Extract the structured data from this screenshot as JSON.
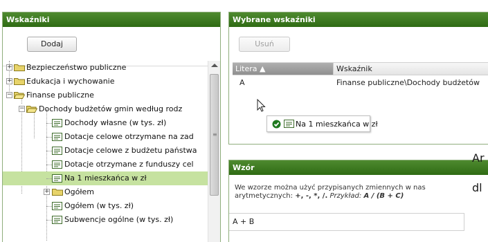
{
  "left_panel": {
    "title": "Wskaźniki",
    "add_button": "Dodaj",
    "tree": [
      {
        "label": "Bezpieczeństwo publiczne",
        "type": "folder",
        "toggle": "+"
      },
      {
        "label": "Edukacja i wychowanie",
        "type": "folder",
        "toggle": "+"
      },
      {
        "label": "Finanse publiczne",
        "type": "folder",
        "toggle": "−"
      },
      {
        "label": "Dochody budżetów gmin według rodz",
        "type": "folder",
        "toggle": "−"
      },
      {
        "label": "Dochody własne (w tys. zł)",
        "type": "indicator"
      },
      {
        "label": "Dotacje celowe otrzymane na zad",
        "type": "indicator"
      },
      {
        "label": "Dotacje celowe z budżetu państwa",
        "type": "indicator"
      },
      {
        "label": "Dotacje otrzymane z funduszy cel",
        "type": "indicator"
      },
      {
        "label": "Na 1 mieszkańca w zł",
        "type": "indicator",
        "selected": true
      },
      {
        "label": "Ogółem",
        "type": "folder",
        "toggle": "+"
      },
      {
        "label": "Ogółem (w tys. zł)",
        "type": "indicator"
      },
      {
        "label": "Subwencje ogólne (w tys. zł)",
        "type": "indicator"
      }
    ]
  },
  "selected_panel": {
    "title": "Wybrane wskaźniki",
    "remove_button": "Usuń",
    "columns": {
      "letter": "Litera ▲",
      "indicator": "Wskaźnik"
    },
    "rows": [
      {
        "letter": "A",
        "indicator": "Finanse publiczne\\Dochody budżetów"
      }
    ],
    "drag_label": "Na 1 mieszkańca w zł"
  },
  "formula_panel": {
    "title": "Wzór",
    "description_line1": "We wzorze można użyć przypisanych zmiennych w nas",
    "description_line2_prefix": "arytmetycznych: ",
    "operators": "+, -, *, /.",
    "example_label": "Przykład:",
    "example_value": "A / (B + C)",
    "formula_value": "A + B"
  },
  "peek_text": {
    "a": "Ar",
    "b": "dl"
  },
  "colors": {
    "header": "#2f6b14",
    "selection": "#c6e2a0",
    "accent_check": "#1f7a1f"
  }
}
